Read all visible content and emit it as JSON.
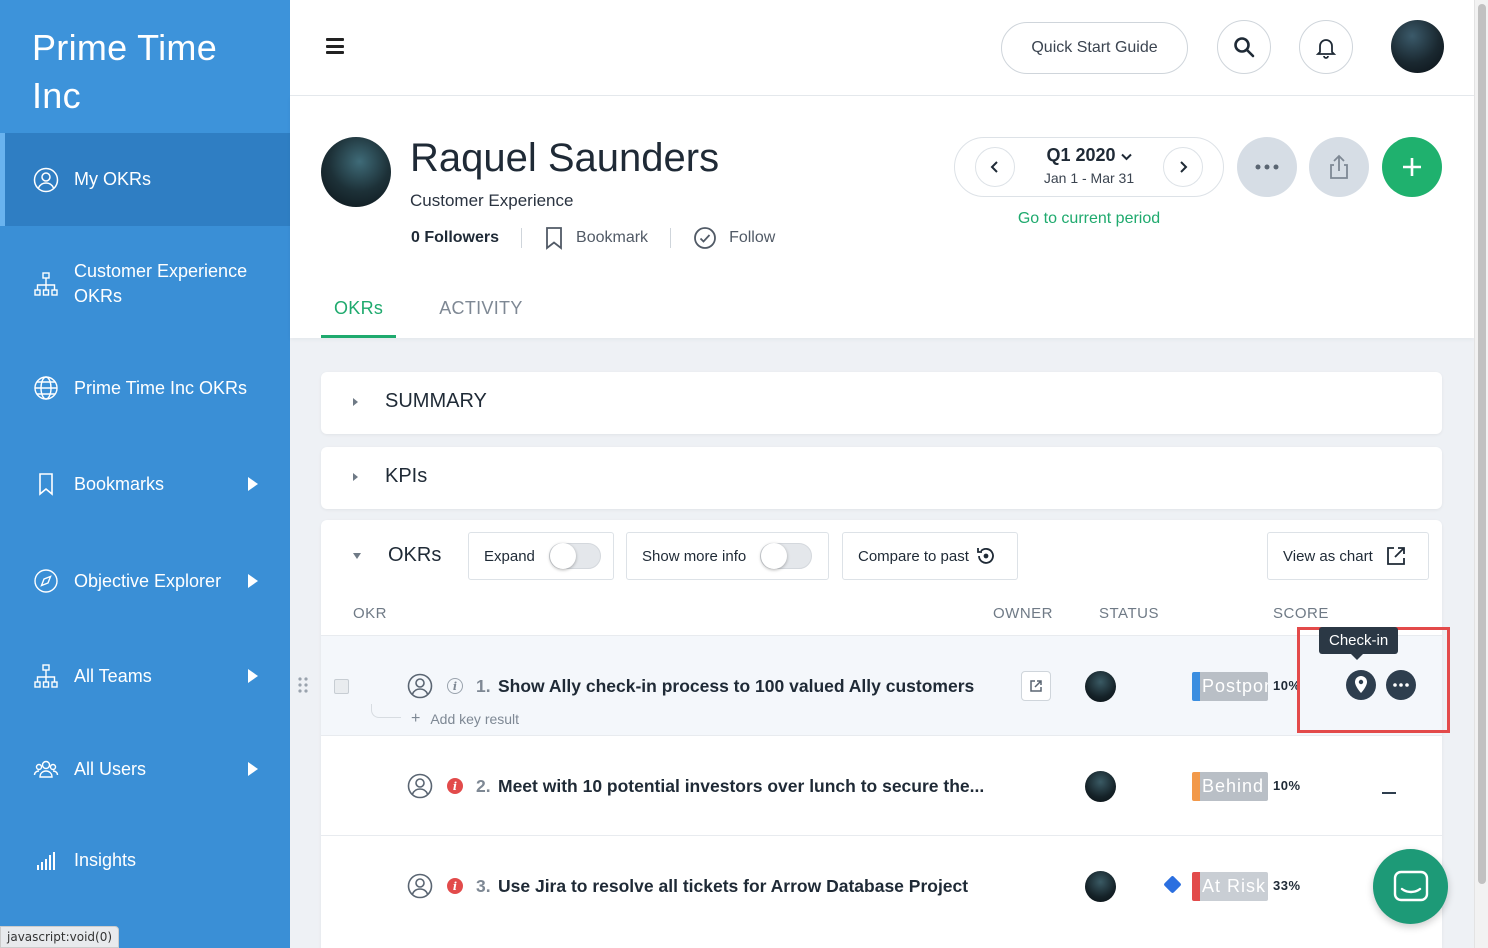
{
  "sidebar": {
    "brand_line1": "Prime Time",
    "brand_line2": "Inc",
    "items": [
      {
        "label": "My OKRs",
        "icon": "user-circle-icon"
      },
      {
        "label_line1": "Customer Experience",
        "label_line2": "OKRs",
        "icon": "org-chart-icon"
      },
      {
        "label": "Prime Time Inc OKRs",
        "icon": "globe-icon"
      },
      {
        "label": "Bookmarks",
        "icon": "bookmark-icon"
      },
      {
        "label": "Objective Explorer",
        "icon": "compass-icon"
      },
      {
        "label": "All Teams",
        "icon": "org-chart-icon"
      },
      {
        "label": "All Users",
        "icon": "users-icon"
      },
      {
        "label": "Insights",
        "icon": "bar-chart-icon"
      }
    ],
    "status_url": "javascript:void(0)"
  },
  "topbar": {
    "quick_start": "Quick Start Guide"
  },
  "profile": {
    "name": "Raquel Saunders",
    "team": "Customer Experience",
    "followers": "0 Followers",
    "bookmark_label": "Bookmark",
    "follow_label": "Follow"
  },
  "period": {
    "title": "Q1 2020",
    "range": "Jan 1 - Mar 31",
    "goto_current": "Go to current period"
  },
  "tabs": [
    {
      "label": "OKRs",
      "active": true
    },
    {
      "label": "ACTIVITY",
      "active": false
    }
  ],
  "panels": {
    "summary": "SUMMARY",
    "kpis": "KPIs",
    "okrs": "OKRs"
  },
  "controls": {
    "expand": "Expand",
    "show_more": "Show more info",
    "compare": "Compare to past",
    "view_chart": "View as chart"
  },
  "columns": {
    "okr": "OKR",
    "owner": "OWNER",
    "status": "STATUS",
    "score": "SCORE"
  },
  "tooltip": "Check-in",
  "add_key_result": "Add key result",
  "okrs": [
    {
      "num": "1.",
      "title": "Show Ally check-in process to 100 valued Ally customers",
      "status": "Postponed",
      "status_color": "#3b8ee0",
      "score": "10%"
    },
    {
      "num": "2.",
      "title": "Meet with 10 potential investors over lunch to secure the...",
      "status": "Behind",
      "status_color": "#f2994a",
      "score": "10%"
    },
    {
      "num": "3.",
      "title": "Use Jira to resolve all tickets for Arrow Database Project",
      "status": "At Risk",
      "status_color": "#e24b4b",
      "score": "33%"
    }
  ],
  "colors": {
    "sidebar": "#3a8fd6",
    "accent_green": "#1faa6e",
    "highlight_red": "#e34a4a"
  }
}
